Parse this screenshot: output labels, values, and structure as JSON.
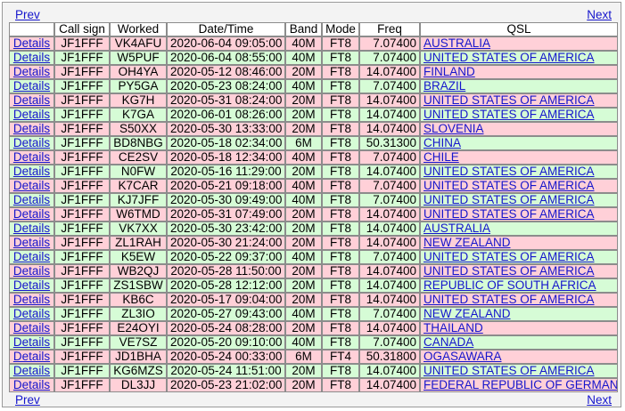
{
  "nav": {
    "prev": "Prev",
    "next": "Next"
  },
  "columns": [
    "",
    "Call sign",
    "Worked",
    "Date/Time",
    "Band",
    "Mode",
    "Freq",
    "QSL"
  ],
  "colors": {
    "pink_row": "#ffd0d8",
    "green_row": "#d6fcd6",
    "link": "#1515cc"
  },
  "rows": [
    {
      "details": "Details",
      "call": "JF1FFF",
      "worked": "VK4AFU",
      "datetime": "2020-06-04 09:05:00",
      "band": "40M",
      "mode": "FT8",
      "freq": "7.07400",
      "qsl": "AUSTRALIA",
      "tone": "pink"
    },
    {
      "details": "Details",
      "call": "JF1FFF",
      "worked": "W5PUF",
      "datetime": "2020-06-04 08:55:00",
      "band": "40M",
      "mode": "FT8",
      "freq": "7.07400",
      "qsl": "UNITED STATES OF AMERICA",
      "tone": "green"
    },
    {
      "details": "Details",
      "call": "JF1FFF",
      "worked": "OH4YA",
      "datetime": "2020-05-12 08:46:00",
      "band": "20M",
      "mode": "FT8",
      "freq": "14.07400",
      "qsl": "FINLAND",
      "tone": "pink"
    },
    {
      "details": "Details",
      "call": "JF1FFF",
      "worked": "PY5GA",
      "datetime": "2020-05-23 08:24:00",
      "band": "40M",
      "mode": "FT8",
      "freq": "7.07400",
      "qsl": "BRAZIL",
      "tone": "green"
    },
    {
      "details": "Details",
      "call": "JF1FFF",
      "worked": "KG7H",
      "datetime": "2020-05-31 08:24:00",
      "band": "20M",
      "mode": "FT8",
      "freq": "14.07400",
      "qsl": "UNITED STATES OF AMERICA",
      "tone": "pink"
    },
    {
      "details": "Details",
      "call": "JF1FFF",
      "worked": "K7GA",
      "datetime": "2020-06-01 08:26:00",
      "band": "20M",
      "mode": "FT8",
      "freq": "14.07400",
      "qsl": "UNITED STATES OF AMERICA",
      "tone": "green"
    },
    {
      "details": "Details",
      "call": "JF1FFF",
      "worked": "S50XX",
      "datetime": "2020-05-30 13:33:00",
      "band": "20M",
      "mode": "FT8",
      "freq": "14.07400",
      "qsl": "SLOVENIA",
      "tone": "pink"
    },
    {
      "details": "Details",
      "call": "JF1FFF",
      "worked": "BD8NBG",
      "datetime": "2020-05-18 02:34:00",
      "band": "6M",
      "mode": "FT8",
      "freq": "50.31300",
      "qsl": "CHINA",
      "tone": "green"
    },
    {
      "details": "Details",
      "call": "JF1FFF",
      "worked": "CE2SV",
      "datetime": "2020-05-18 12:34:00",
      "band": "40M",
      "mode": "FT8",
      "freq": "7.07400",
      "qsl": "CHILE",
      "tone": "pink"
    },
    {
      "details": "Details",
      "call": "JF1FFF",
      "worked": "N0FW",
      "datetime": "2020-05-16 11:29:00",
      "band": "20M",
      "mode": "FT8",
      "freq": "14.07400",
      "qsl": "UNITED STATES OF AMERICA",
      "tone": "green"
    },
    {
      "details": "Details",
      "call": "JF1FFF",
      "worked": "K7CAR",
      "datetime": "2020-05-21 09:18:00",
      "band": "40M",
      "mode": "FT8",
      "freq": "7.07400",
      "qsl": "UNITED STATES OF AMERICA",
      "tone": "pink"
    },
    {
      "details": "Details",
      "call": "JF1FFF",
      "worked": "KJ7JFF",
      "datetime": "2020-05-30 09:49:00",
      "band": "40M",
      "mode": "FT8",
      "freq": "7.07400",
      "qsl": "UNITED STATES OF AMERICA",
      "tone": "green"
    },
    {
      "details": "Details",
      "call": "JF1FFF",
      "worked": "W6TMD",
      "datetime": "2020-05-31 07:49:00",
      "band": "20M",
      "mode": "FT8",
      "freq": "14.07400",
      "qsl": "UNITED STATES OF AMERICA",
      "tone": "pink"
    },
    {
      "details": "Details",
      "call": "JF1FFF",
      "worked": "VK7XX",
      "datetime": "2020-05-30 23:42:00",
      "band": "20M",
      "mode": "FT8",
      "freq": "14.07400",
      "qsl": "AUSTRALIA",
      "tone": "green"
    },
    {
      "details": "Details",
      "call": "JF1FFF",
      "worked": "ZL1RAH",
      "datetime": "2020-05-30 21:24:00",
      "band": "20M",
      "mode": "FT8",
      "freq": "14.07400",
      "qsl": "NEW ZEALAND",
      "tone": "pink"
    },
    {
      "details": "Details",
      "call": "JF1FFF",
      "worked": "K5EW",
      "datetime": "2020-05-22 09:37:00",
      "band": "40M",
      "mode": "FT8",
      "freq": "7.07400",
      "qsl": "UNITED STATES OF AMERICA",
      "tone": "green"
    },
    {
      "details": "Details",
      "call": "JF1FFF",
      "worked": "WB2QJ",
      "datetime": "2020-05-28 11:50:00",
      "band": "20M",
      "mode": "FT8",
      "freq": "14.07400",
      "qsl": "UNITED STATES OF AMERICA",
      "tone": "pink"
    },
    {
      "details": "Details",
      "call": "JF1FFF",
      "worked": "ZS1SBW",
      "datetime": "2020-05-28 12:12:00",
      "band": "20M",
      "mode": "FT8",
      "freq": "14.07400",
      "qsl": "REPUBLIC OF SOUTH AFRICA",
      "tone": "green"
    },
    {
      "details": "Details",
      "call": "JF1FFF",
      "worked": "KB6C",
      "datetime": "2020-05-17 09:04:00",
      "band": "20M",
      "mode": "FT8",
      "freq": "14.07400",
      "qsl": "UNITED STATES OF AMERICA",
      "tone": "pink"
    },
    {
      "details": "Details",
      "call": "JF1FFF",
      "worked": "ZL3IO",
      "datetime": "2020-05-27 09:43:00",
      "band": "40M",
      "mode": "FT8",
      "freq": "7.07400",
      "qsl": "NEW ZEALAND",
      "tone": "green"
    },
    {
      "details": "Details",
      "call": "JF1FFF",
      "worked": "E24OYI",
      "datetime": "2020-05-24 08:28:00",
      "band": "20M",
      "mode": "FT8",
      "freq": "14.07400",
      "qsl": "THAILAND",
      "tone": "pink"
    },
    {
      "details": "Details",
      "call": "JF1FFF",
      "worked": "VE7SZ",
      "datetime": "2020-05-20 09:10:00",
      "band": "40M",
      "mode": "FT8",
      "freq": "7.07400",
      "qsl": "CANADA",
      "tone": "green"
    },
    {
      "details": "Details",
      "call": "JF1FFF",
      "worked": "JD1BHA",
      "datetime": "2020-05-24 00:33:00",
      "band": "6M",
      "mode": "FT4",
      "freq": "50.31800",
      "qsl": "OGASAWARA",
      "tone": "pink"
    },
    {
      "details": "Details",
      "call": "JF1FFF",
      "worked": "KG6MZS",
      "datetime": "2020-05-24 11:51:00",
      "band": "20M",
      "mode": "FT8",
      "freq": "14.07400",
      "qsl": "UNITED STATES OF AMERICA",
      "tone": "green"
    },
    {
      "details": "Details",
      "call": "JF1FFF",
      "worked": "DL3JJ",
      "datetime": "2020-05-23 21:02:00",
      "band": "20M",
      "mode": "FT8",
      "freq": "14.07400",
      "qsl": "FEDERAL REPUBLIC OF GERMANY",
      "tone": "pink"
    }
  ]
}
